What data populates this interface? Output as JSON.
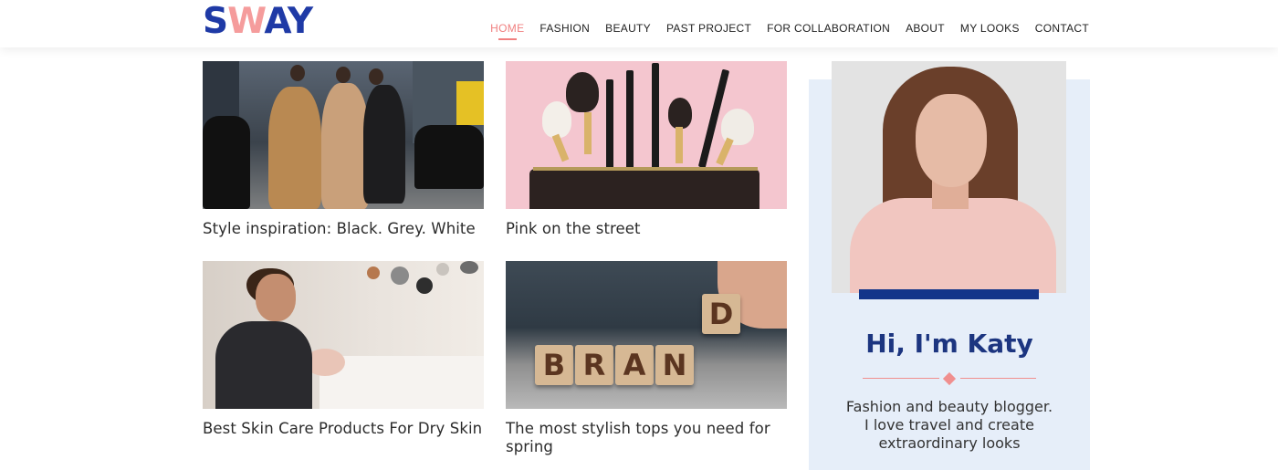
{
  "brand": {
    "logo_part1": "S",
    "logo_part2": "W",
    "logo_part3": "AY"
  },
  "nav": [
    {
      "label": "HOME",
      "active": true
    },
    {
      "label": "FASHION"
    },
    {
      "label": "BEAUTY"
    },
    {
      "label": "PAST PROJECT"
    },
    {
      "label": "FOR COLLABORATION"
    },
    {
      "label": "ABOUT"
    },
    {
      "label": "MY LOOKS"
    },
    {
      "label": "CONTACT"
    }
  ],
  "posts": [
    {
      "title": "Style inspiration: Black. Grey. White"
    },
    {
      "title": "Pink on the street"
    },
    {
      "title": "Best Skin Care Products For Dry Skin"
    },
    {
      "title": "The most stylish tops you need for spring"
    }
  ],
  "brand_blocks": {
    "letters": [
      "B",
      "R",
      "A",
      "N",
      "D"
    ]
  },
  "sidebar": {
    "name": "Hi, I'm Katy",
    "bio_line1": "Fashion and beauty blogger.",
    "bio_line2": "I love travel and create",
    "bio_line3": "extraordinary looks"
  },
  "colors": {
    "brand_blue": "#1f3aa6",
    "accent_pink": "#f08080",
    "sidebar_bg": "#e6eef9",
    "name_blue": "#1c3580"
  }
}
